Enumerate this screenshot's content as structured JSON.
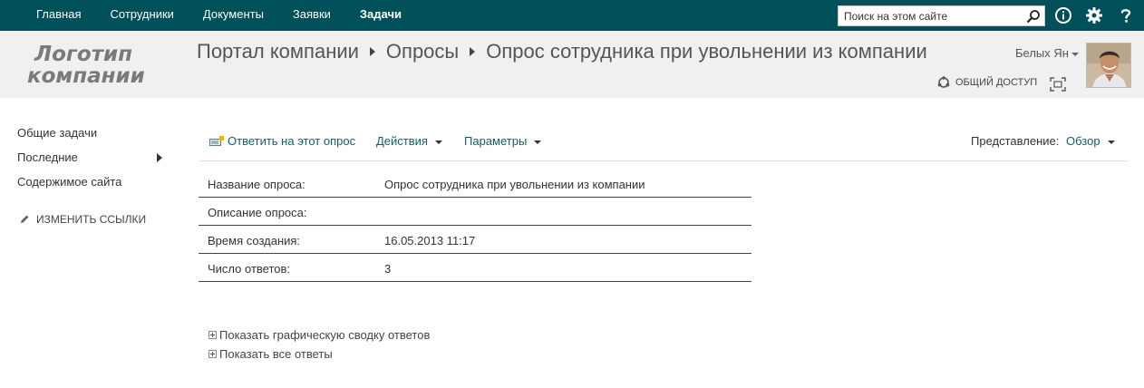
{
  "topnav": {
    "items": [
      {
        "label": "Главная"
      },
      {
        "label": "Сотрудники"
      },
      {
        "label": "Документы"
      },
      {
        "label": "Заявки"
      },
      {
        "label": "Задачи"
      }
    ],
    "active_index": 4,
    "search": {
      "placeholder": "Поиск на этом сайте",
      "value": ""
    },
    "icons": [
      "search-icon",
      "info-icon",
      "gear-icon",
      "help-icon"
    ]
  },
  "header": {
    "logo_line1": "Логотип",
    "logo_line2": "компании",
    "breadcrumb": [
      "Портал компании",
      "Опросы",
      "Опрос сотрудника при увольнении из компании"
    ],
    "user_name": "Белых Ян",
    "share_label": "ОБЩИЙ ДОСТУП"
  },
  "leftnav": {
    "items": [
      {
        "label": "Общие задачи"
      },
      {
        "label": "Последние"
      },
      {
        "label": "Содержимое сайта"
      }
    ],
    "edit_links": "ИЗМЕНИТЬ ССЫЛКИ"
  },
  "toolbar": {
    "respond": "Ответить на этот опрос",
    "actions": "Действия",
    "settings": "Параметры",
    "view_label": "Представление:",
    "view_value": "Обзор"
  },
  "details": [
    {
      "key": "Название опроса:",
      "value": "Опрос сотрудника при увольнении из компании"
    },
    {
      "key": "Описание опроса:",
      "value": ""
    },
    {
      "key": "Время создания:",
      "value": "16.05.2013 11:17"
    },
    {
      "key": "Число ответов:",
      "value": "3"
    }
  ],
  "expand_links": [
    {
      "label": "Показать графическую сводку ответов"
    },
    {
      "label": "Показать все ответы"
    }
  ],
  "colors": {
    "topbar": "#00505a",
    "header_bg": "#f0f0f0",
    "link": "#0f5f6b"
  }
}
